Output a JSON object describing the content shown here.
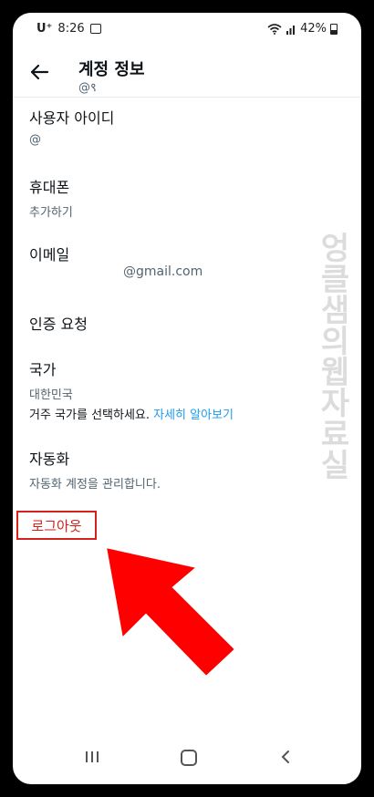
{
  "status_bar": {
    "carrier": "U⁺",
    "time": "8:26",
    "battery": "42%"
  },
  "header": {
    "title": "계정 정보",
    "subtitle": "@९"
  },
  "items": {
    "username": {
      "label": "사용자 아이디",
      "value": "@"
    },
    "phone": {
      "label": "휴대폰",
      "value": "추가하기"
    },
    "email": {
      "label": "이메일",
      "value": "@gmail.com"
    },
    "verification": {
      "label": "인증 요청"
    },
    "country": {
      "label": "국가",
      "value": "대한민국",
      "description": "거주 국가를 선택하세요.",
      "learn_more": "자세히 알아보기"
    },
    "automation": {
      "label": "자동화",
      "value": "자동화 계정을 관리합니다."
    }
  },
  "logout": {
    "label": "로그아웃"
  },
  "watermark": "엉클샘의웹자료실",
  "colors": {
    "accent": "#1d9bf0",
    "logout_red": "#d3221c",
    "arrow_red": "#ff0000"
  },
  "icons": [
    "back-arrow-icon",
    "wifi-icon",
    "signal-icon",
    "battery-icon",
    "gallery-icon",
    "recent-apps-icon",
    "home-icon",
    "nav-back-icon"
  ]
}
